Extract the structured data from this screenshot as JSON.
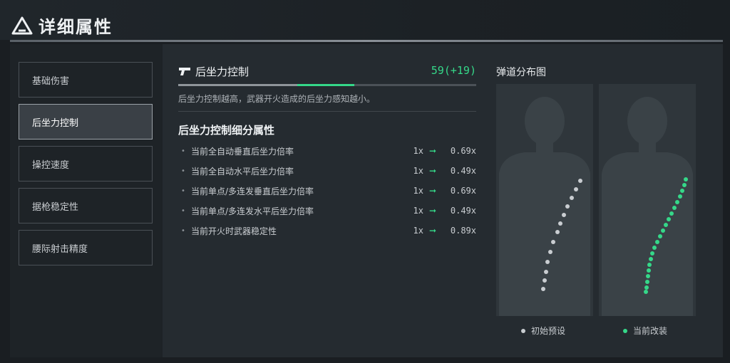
{
  "header": {
    "title": "详细属性",
    "logo_icon": "triangle-a-logo-icon"
  },
  "sidebar": {
    "tabs": [
      {
        "label": "基础伤害",
        "active": false
      },
      {
        "label": "后坐力控制",
        "active": true
      },
      {
        "label": "操控速度",
        "active": false
      },
      {
        "label": "据枪稳定性",
        "active": false
      },
      {
        "label": "腰际射击精度",
        "active": false
      }
    ]
  },
  "stat": {
    "icon": "pistol-icon",
    "title": "后坐力控制",
    "value": "59(+19)",
    "progress_base_fraction": 0.4,
    "progress_bonus_fraction": 0.19,
    "description": "后坐力控制越高，武器开火造成的后坐力感知越小。"
  },
  "breakdown": {
    "title": "后坐力控制细分属性",
    "rows": [
      {
        "label": "当前全自动垂直后坐力倍率",
        "from": "1x",
        "to": "0.69x"
      },
      {
        "label": "当前全自动水平后坐力倍率",
        "from": "1x",
        "to": "0.49x"
      },
      {
        "label": "当前单点/多连发垂直后坐力倍率",
        "from": "1x",
        "to": "0.69x"
      },
      {
        "label": "当前单点/多连发水平后坐力倍率",
        "from": "1x",
        "to": "0.49x"
      },
      {
        "label": "当前开火时武器稳定性",
        "from": "1x",
        "to": "0.89x"
      }
    ]
  },
  "spread": {
    "title": "弹道分布图",
    "legend": {
      "initial": "初始预设",
      "current": "当前改装"
    },
    "colors": {
      "initial": "#c9cdd1",
      "current": "#35d889",
      "accent": "#35d889"
    }
  }
}
